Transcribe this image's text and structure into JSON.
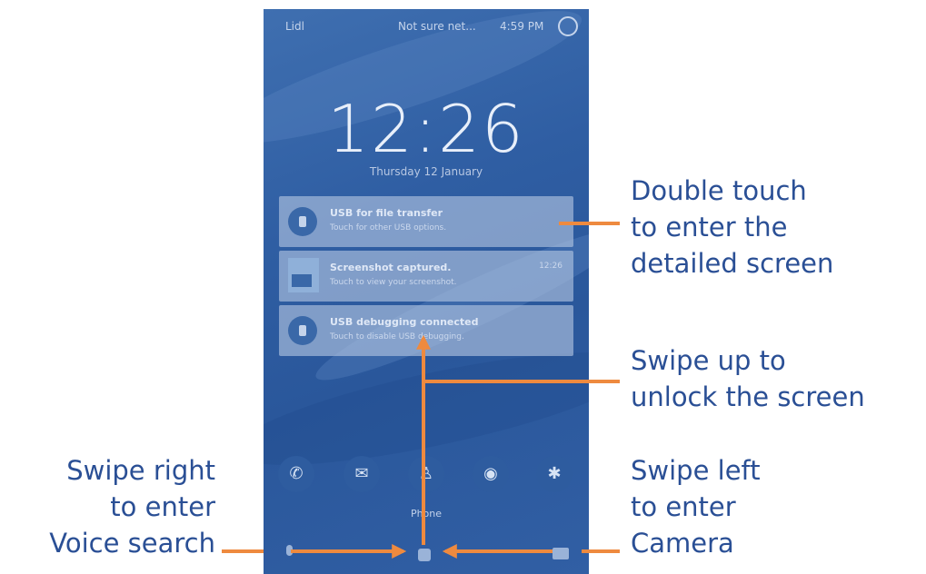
{
  "status_bar": {
    "carrier": "Lidl",
    "network": "Not sure net...",
    "battery": "4:59 PM"
  },
  "lock_screen": {
    "time": "12:26",
    "date": "Thursday 12 January",
    "notifications": [
      {
        "title": "USB for file transfer",
        "body": "Touch for other USB options.",
        "icon": "usb-icon"
      },
      {
        "title": "Screenshot captured.",
        "body": "Touch to view your screenshot.",
        "time": "12:26",
        "icon": "screenshot-thumbnail"
      },
      {
        "title": "USB debugging connected",
        "body": "Touch to disable USB debugging.",
        "icon": "bug-icon"
      }
    ],
    "shortcuts": [
      {
        "icon": "phone-icon",
        "glyph": "✆"
      },
      {
        "icon": "messages-icon",
        "glyph": "✉"
      },
      {
        "icon": "contacts-icon",
        "glyph": "♙"
      },
      {
        "icon": "browser-icon",
        "glyph": "◉"
      },
      {
        "icon": "settings-icon",
        "glyph": "✱"
      }
    ],
    "shortcut_label": "Phone"
  },
  "callouts": {
    "double_touch": "Double touch\nto enter the\ndetailed screen",
    "swipe_up": "Swipe up to\nunlock the screen",
    "swipe_right": "Swipe right\nto enter\nVoice search",
    "swipe_left": "Swipe left\nto enter\nCamera"
  },
  "colors": {
    "callout_text": "#2a4f95",
    "arrow": "#ee8a3f",
    "wallpaper": "#2f5ea3"
  }
}
